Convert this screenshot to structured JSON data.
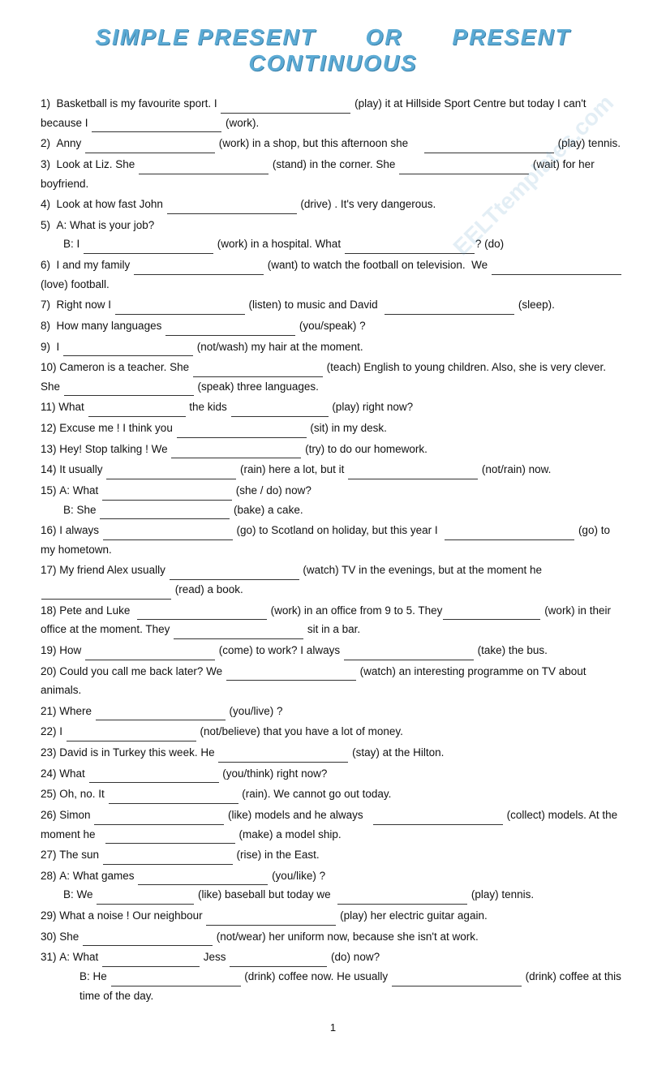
{
  "title": {
    "part1": "SIMPLE PRESENT",
    "or": "OR",
    "part2": "PRESENT CONTINUOUS"
  },
  "exercises": [
    {
      "num": "1)",
      "text": "Basketball is my favourite sport. I ....................................... (play) it at Hillside Sport Centre but today I can't because I ....................................... (work)."
    },
    {
      "num": "2)",
      "text": "Anny ....................................... (work) in a shop, but this afternoon she     ....................................... (play) tennis."
    },
    {
      "num": "3)",
      "text": "Look at Liz. She ....................................... (stand) in the corner. She ....................................... (wait) for her boyfriend."
    },
    {
      "num": "4)",
      "text": "Look at how fast John ....................................... (drive) . It's very dangerous."
    },
    {
      "num": "5)",
      "text": "A: What is your job?",
      "sub": "B: I ....................................... (work) in a hospital. What ......................................? (do)"
    },
    {
      "num": "6)",
      "text": "I and my family ....................................... (want) to watch the football on television.  We ....................................... (love) football."
    },
    {
      "num": "7)",
      "text": "Right now I ....................................... (listen) to music and David  ....................................... (sleep)."
    },
    {
      "num": "8)",
      "text": "How many languages ....................................... (you/speak) ?"
    },
    {
      "num": "9)",
      "text": "I ....................................... (not/wash) my hair at the moment."
    },
    {
      "num": "10)",
      "text": "Cameron is a teacher. She ....................................... (teach) English to young children. Also, she is very clever. She ....................................... (speak) three languages."
    },
    {
      "num": "11)",
      "text": "What ......................................  the kids ....................................... (play) right now?"
    },
    {
      "num": "12)",
      "text": "Excuse me ! I think you ....................................... (sit) in my desk."
    },
    {
      "num": "13)",
      "text": "Hey! Stop talking ! We ....................................... (try) to do our homework."
    },
    {
      "num": "14)",
      "text": "It usually ....................................... (rain) here a lot, but it ....................................... (not/rain) now."
    },
    {
      "num": "15)",
      "text": "A: What ....................................... (she / do) now?",
      "sub": "B: She ....................................... (bake) a cake."
    },
    {
      "num": "16)",
      "text": "I always ....................................... (go) to Scotland on holiday, but this year I  ....................................... (go) to my hometown."
    },
    {
      "num": "17)",
      "text": "My friend Alex usually ....................................... (watch) TV in the evenings, but at the moment he ....................................... (read) a book."
    },
    {
      "num": "18)",
      "text": "Pete and Luke  ....................................... (work) in an office from 9 to 5. They....................................... (work) in their office at the moment. They ....................................... sit in a bar."
    },
    {
      "num": "19)",
      "text": "How ....................................... (come) to work? I always ....................................... (take) the bus."
    },
    {
      "num": "20)",
      "text": "Could you call me back later? We ....................................... (watch) an interesting programme on TV about animals."
    },
    {
      "num": "21)",
      "text": "Where ....................................... (you/live) ?"
    },
    {
      "num": "22)",
      "text": "I ....................................... (not/believe) that you have a lot of money."
    },
    {
      "num": "23)",
      "text": "David is in Turkey this week. He ....................................... (stay) at the Hilton."
    },
    {
      "num": "24)",
      "text": "What ....................................... (you/think) right now?"
    },
    {
      "num": "25)",
      "text": "Oh, no. It ....................................... (rain). We cannot go out today."
    },
    {
      "num": "26)",
      "text": "Simon ....................................... (like) models and he always   ....................................... (collect) models. At the moment he   ....................................... (make) a model ship."
    },
    {
      "num": "27)",
      "text": "The sun ....................................... (rise) in the East."
    },
    {
      "num": "28)",
      "text": "A: What games ....................................... (you/like) ?",
      "sub": "B: We ....................................... (like) baseball but today we  ....................................... (play) tennis."
    },
    {
      "num": "29)",
      "text": "What a noise ! Our neighbour ....................................... (play) her electric guitar again."
    },
    {
      "num": "30)",
      "text": "She ....................................... (not/wear) her uniform now, because she isn't at work."
    },
    {
      "num": "31)",
      "text": "A: What ....................................... Jess ....................................... (do) now?",
      "sub": "B: He ....................................... (drink) coffee now. He usually ....................................... (drink) coffee at this time of the day."
    }
  ],
  "page_number": "1",
  "watermark": "EELTtemplates.com"
}
